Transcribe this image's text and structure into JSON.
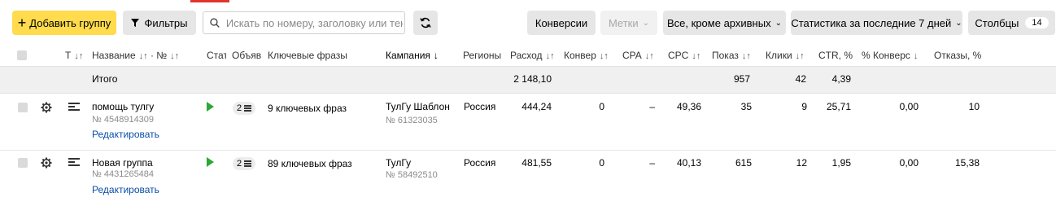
{
  "toolbar": {
    "add_group_label": "Добавить группу",
    "filters_label": "Фильтры",
    "search_placeholder": "Искать по номеру, заголовку или тексту",
    "conversions_label": "Конверсии",
    "tags_label": "Метки",
    "status_filter_label": "Все, кроме архивных",
    "stats_period_label": "Статистика за последние 7 дней",
    "columns_label": "Столбцы",
    "columns_count": "14"
  },
  "table": {
    "headers": {
      "type": "Т",
      "name": "Название",
      "number": "№",
      "status": "Стат",
      "ads": "Объяв",
      "keywords": "Ключевые фразы",
      "campaign": "Кампания",
      "regions": "Регионы",
      "cost": "Расход",
      "conversions": "Конвер",
      "cpa": "CPA",
      "cpc": "CPC",
      "impressions": "Показ",
      "clicks": "Клики",
      "ctr": "CTR, %",
      "conv_rate": "% Конверс",
      "bounces": "Отказы, %"
    },
    "total": {
      "label": "Итого",
      "cost": "2 148,10",
      "impressions": "957",
      "clicks": "42",
      "ctr": "4,39"
    },
    "rows": [
      {
        "name": "помощь тулгу",
        "group_id": "№ 4548914309",
        "edit_label": "Редактировать",
        "ads_count": "2",
        "keywords": "9 ключевых фраз",
        "campaign": "ТулГу Шаблон",
        "campaign_id": "№ 61323035",
        "region": "Россия",
        "cost": "444,24",
        "conversions": "0",
        "cpa": "–",
        "cpc": "49,36",
        "impressions": "35",
        "clicks": "9",
        "ctr": "25,71",
        "conv_rate": "0,00",
        "bounces": "10"
      },
      {
        "name": "Новая группа",
        "group_id": "№ 4431265484",
        "edit_label": "Редактировать",
        "ads_count": "2",
        "keywords": "89 ключевых фраз",
        "campaign": "ТулГу",
        "campaign_id": "№ 58492510",
        "region": "Россия",
        "cost": "481,55",
        "conversions": "0",
        "cpa": "–",
        "cpc": "40,13",
        "impressions": "615",
        "clicks": "12",
        "ctr": "1,95",
        "conv_rate": "0,00",
        "bounces": "15,38"
      }
    ]
  },
  "icons": {
    "add": "plus-icon",
    "filter": "funnel-icon",
    "search": "search-icon",
    "refresh": "refresh-icon",
    "settings": "gear-icon",
    "group_type": "list-icon",
    "status_active": "play-icon"
  },
  "colors": {
    "accent_yellow": "#ffdb4d",
    "status_green": "#2ba836",
    "link_blue": "#0a4ea8",
    "tab_red": "#e0352b"
  }
}
